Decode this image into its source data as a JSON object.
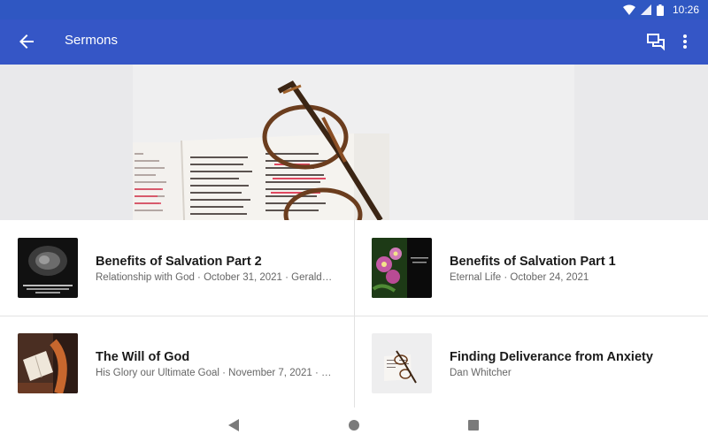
{
  "status": {
    "time": "10:26"
  },
  "appbar": {
    "title": "Sermons"
  },
  "sermons": [
    {
      "title": "Benefits of Salvation Part 2",
      "subtitle": "Relationship with God · October 31, 2021 · Gerald…"
    },
    {
      "title": "Benefits of Salvation Part 1",
      "subtitle": "Eternal Life · October 24, 2021"
    },
    {
      "title": "The Will of God",
      "subtitle": "His Glory our Ultimate Goal · November 7, 2021 · D…"
    },
    {
      "title": "Finding Deliverance from Anxiety",
      "subtitle": "Dan Whitcher"
    }
  ],
  "colors": {
    "appbar": "#3556c6",
    "statusbar": "#2f57c2"
  }
}
